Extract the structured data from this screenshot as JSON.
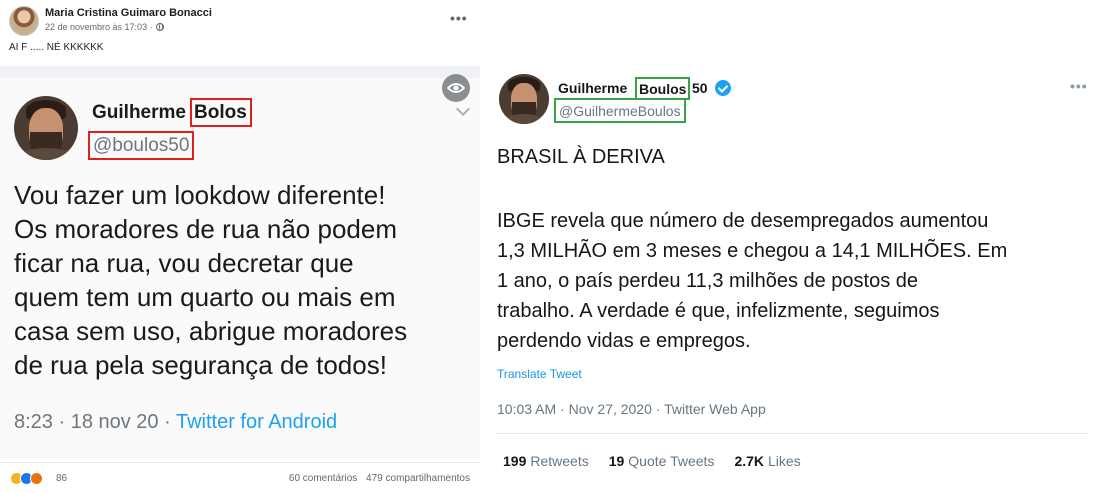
{
  "facebook": {
    "author": "Maria Cristina Guimaro Bonacci",
    "date": "22 de novembro às 17:03",
    "separator": "·",
    "caption": "AI  F ..... NÉ  KKKKKK",
    "reaction_count": "86",
    "comments": "60 comentários",
    "shares": "479 compartilhamentos",
    "embedded_tweet": {
      "name_first": "Guilherme",
      "name_last": "Bolos",
      "handle": "@boulos50",
      "lines": [
        "Vou fazer um lookdow diferente!",
        "Os moradores de rua não podem",
        "ficar na rua, vou decretar que",
        "quem tem um quarto ou mais em",
        "casa sem uso, abrigue moradores",
        "de rua pela segurança de todos!"
      ],
      "time": "8:23 · 18 nov 20 · ",
      "source": "Twitter for Android"
    },
    "highlight_color": "#e0201e"
  },
  "tweet": {
    "name_first": "Guilherme",
    "name_last": "Boulos",
    "name_suffix": "50",
    "handle": "@GuilhermeBoulos",
    "title": "BRASIL À DERIVA",
    "body_lines": [
      "IBGE revela que número de desempregados aumentou",
      "1,3 MILHÃO em 3 meses e chegou a 14,1 MILHÕES. Em",
      "1 ano, o país perdeu 11,3 milhões de postos de",
      "trabalho. A verdade é que, infelizmente, seguimos",
      "perdendo vidas e empregos."
    ],
    "translate": "Translate Tweet",
    "timestamp": "10:03 AM · Nov 27, 2020 · Twitter Web App",
    "retweets_count": "199",
    "retweets_label": "Retweets",
    "quotes_count": "19",
    "quotes_label": "Quote Tweets",
    "likes_count": "2.7K",
    "likes_label": "Likes",
    "highlight_color": "#37a447"
  }
}
